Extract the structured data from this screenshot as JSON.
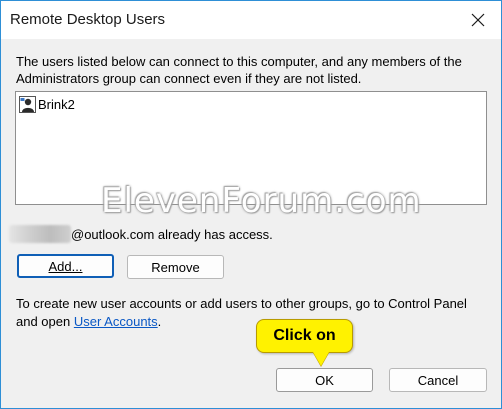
{
  "window": {
    "title": "Remote Desktop Users",
    "close_icon": "close-icon",
    "accent_border": "#2e8fd6"
  },
  "description": "The users listed below can connect to this computer, and any members of the Administrators group can connect even if they are not listed.",
  "users_list": {
    "items": [
      {
        "label": "Brink2",
        "icon": "user-icon"
      }
    ]
  },
  "watermark": "ElevenForum.com",
  "access": {
    "email_suffix": "@outlook.com already has access."
  },
  "buttons": {
    "add_label": "Add...",
    "remove_label": "Remove",
    "ok_label": "OK",
    "cancel_label": "Cancel"
  },
  "info": {
    "text_before": "To create new user accounts or add users to other groups, go to Control Panel and open ",
    "link_label": "User Accounts",
    "text_after": "."
  },
  "callout": {
    "label": "Click on",
    "color": "#fff200"
  }
}
